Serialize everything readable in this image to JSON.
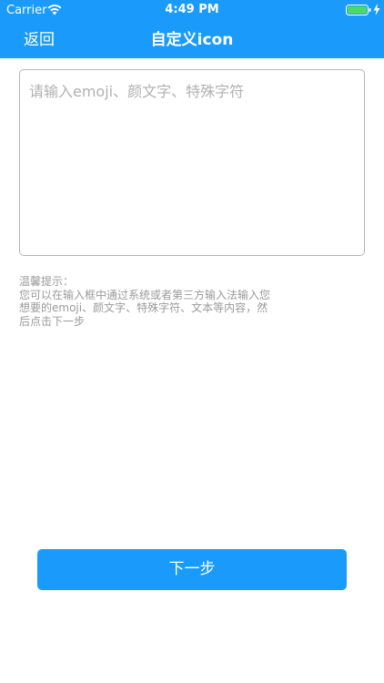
{
  "status_bar": {
    "carrier": "Carrier",
    "time": "4:49 PM",
    "wifi_icon": "wifi-icon",
    "battery_icon": "battery-full-icon",
    "charge_icon": "charging-bolt-icon"
  },
  "nav": {
    "back_label": "返回",
    "title": "自定义icon"
  },
  "input": {
    "placeholder": "请输入emoji、颜文字、特殊字符",
    "value": ""
  },
  "tip": {
    "text": "温馨提示：\n您可以在输入框中通过系统或者第三方输入法输入您想要的emoji、颜文字、特殊字符、文本等内容，然后点击下一步"
  },
  "next_button": {
    "label": "下一步"
  },
  "colors": {
    "accent": "#1a9bfc",
    "battery": "#4cd964",
    "tip_text": "#9a9a9a",
    "placeholder": "#b0b0b0"
  }
}
